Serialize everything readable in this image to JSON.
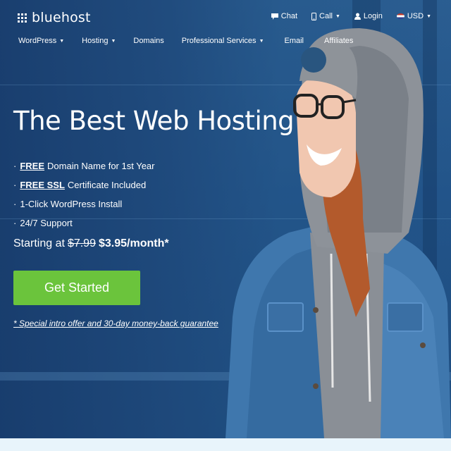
{
  "brand": {
    "name": "bluehost"
  },
  "util_nav": {
    "chat": "Chat",
    "call": "Call",
    "login": "Login",
    "currency": "USD"
  },
  "main_nav": [
    {
      "label": "WordPress",
      "dropdown": true
    },
    {
      "label": "Hosting",
      "dropdown": true
    },
    {
      "label": "Domains",
      "dropdown": false
    },
    {
      "label": "Professional Services",
      "dropdown": true
    },
    {
      "label": "Email",
      "dropdown": false
    },
    {
      "label": "Affiliates",
      "dropdown": false
    }
  ],
  "hero": {
    "title": "The Best Web Hosting",
    "features": [
      {
        "emphasis": "FREE",
        "text": "Domain Name for 1st Year"
      },
      {
        "emphasis": "FREE SSL",
        "text": "Certificate Included"
      },
      {
        "emphasis": "",
        "text": "1-Click WordPress Install"
      },
      {
        "emphasis": "",
        "text": "24/7 Support"
      }
    ],
    "price_prefix": "Starting at",
    "price_old": "$7.99",
    "price_new": "$3.95/month*",
    "cta_label": "Get Started",
    "guarantee": "* Special intro offer and 30-day money-back guarantee"
  },
  "colors": {
    "cta_green": "#6bc43c",
    "hero_blue": "#1d4a7a",
    "bottom_strip": "#e8f4fb"
  },
  "icons": [
    "chat-icon",
    "phone-icon",
    "user-icon",
    "flag-icon",
    "chevron-down-icon"
  ]
}
